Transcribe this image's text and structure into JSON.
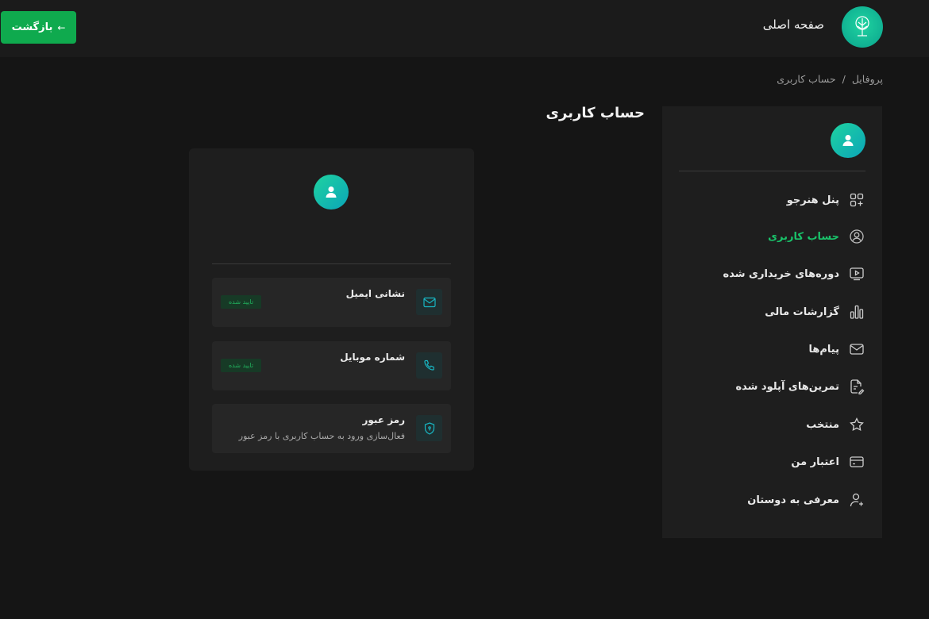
{
  "header": {
    "back_label": "بازگشت",
    "back_arrow": "←",
    "home_title": "صفحه اصلی",
    "logo_icon": "tree-logo-icon"
  },
  "breadcrumb": {
    "items": [
      "پروفایل",
      "حساب کاربری"
    ],
    "separator": "/"
  },
  "page": {
    "title": "حساب کاربری"
  },
  "sidebar": {
    "items": [
      {
        "label": "پنل هنرجو",
        "icon": "dashboard-icon",
        "active": false
      },
      {
        "label": "حساب کاربری",
        "icon": "user-circle-icon",
        "active": true
      },
      {
        "label": "دوره‌های خریداری شده",
        "icon": "video-course-icon",
        "active": false
      },
      {
        "label": "گزارشات مالی",
        "icon": "bar-chart-icon",
        "active": false
      },
      {
        "label": "پیام‌ها",
        "icon": "mail-icon",
        "active": false
      },
      {
        "label": "تمرین‌های آپلود شده",
        "icon": "upload-document-icon",
        "active": false
      },
      {
        "label": "منتخب",
        "icon": "star-icon",
        "active": false
      },
      {
        "label": "اعتبار من",
        "icon": "credit-card-icon",
        "active": false
      },
      {
        "label": "معرفی به دوستان",
        "icon": "add-user-icon",
        "active": false
      }
    ]
  },
  "profile_card": {
    "avatar_icon": "user-icon",
    "rows": [
      {
        "title": "نشانی ایمیل",
        "icon": "mail-icon",
        "badge": "تایید شده"
      },
      {
        "title": "شماره موبایل",
        "icon": "phone-icon",
        "badge": "تایید شده"
      },
      {
        "title": "رمز عبور",
        "icon": "shield-lock-icon",
        "subtitle": "فعال‌سازی ورود به حساب کاربری با رمز عبور"
      }
    ]
  },
  "colors": {
    "accent_green": "#0faa4e",
    "active_text": "#19c36a",
    "teal": "#1fd3a0",
    "background": "#151515",
    "panel": "#1e1e1e"
  }
}
